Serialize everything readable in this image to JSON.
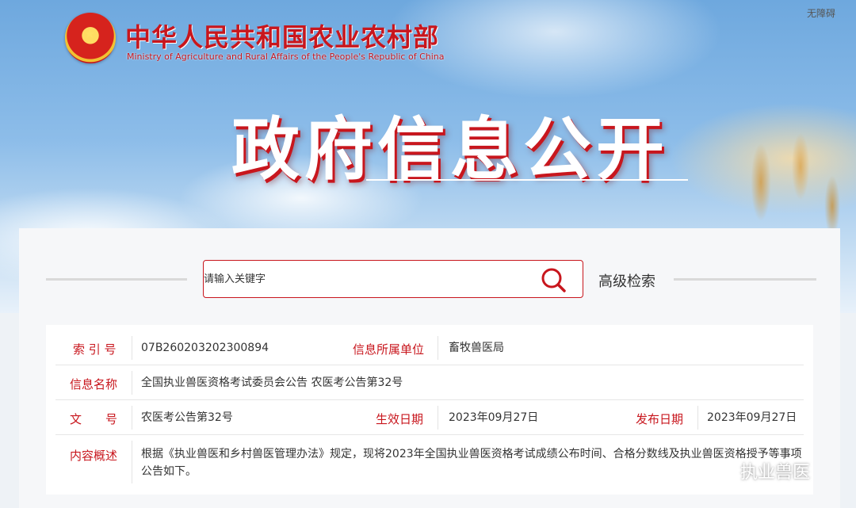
{
  "header": {
    "accessibility_link": "无障碍",
    "ministry_name_cn": "中华人民共和国农业农村部",
    "ministry_name_en": "Ministry of Agriculture and Rural Affairs of the People's Republic of China",
    "banner_title": "政府信息公开"
  },
  "search": {
    "placeholder": "请输入关键字",
    "advanced_label": "高级检索"
  },
  "info": {
    "index_label": "索 引 号",
    "index_value": "07B260203202300894",
    "unit_label": "信息所属单位",
    "unit_value": "畜牧兽医局",
    "name_label": "信息名称",
    "name_value": "全国执业兽医资格考试委员会公告 农医考公告第32号",
    "doc_label": "文　　号",
    "doc_value": "农医考公告第32号",
    "effective_label": "生效日期",
    "effective_value": "2023年09月27日",
    "publish_label": "发布日期",
    "publish_value": "2023年09月27日",
    "summary_label": "内容概述",
    "summary_value": "根据《执业兽医和乡村兽医管理办法》规定，现将2023年全国执业兽医资格考试成绩公布时间、合格分数线及执业兽医资格授予等事项公告如下。"
  },
  "watermark": {
    "text": "执业兽医",
    "icon": "wechat-icon"
  },
  "colors": {
    "accent_red": "#c8161d",
    "text": "#333333"
  }
}
